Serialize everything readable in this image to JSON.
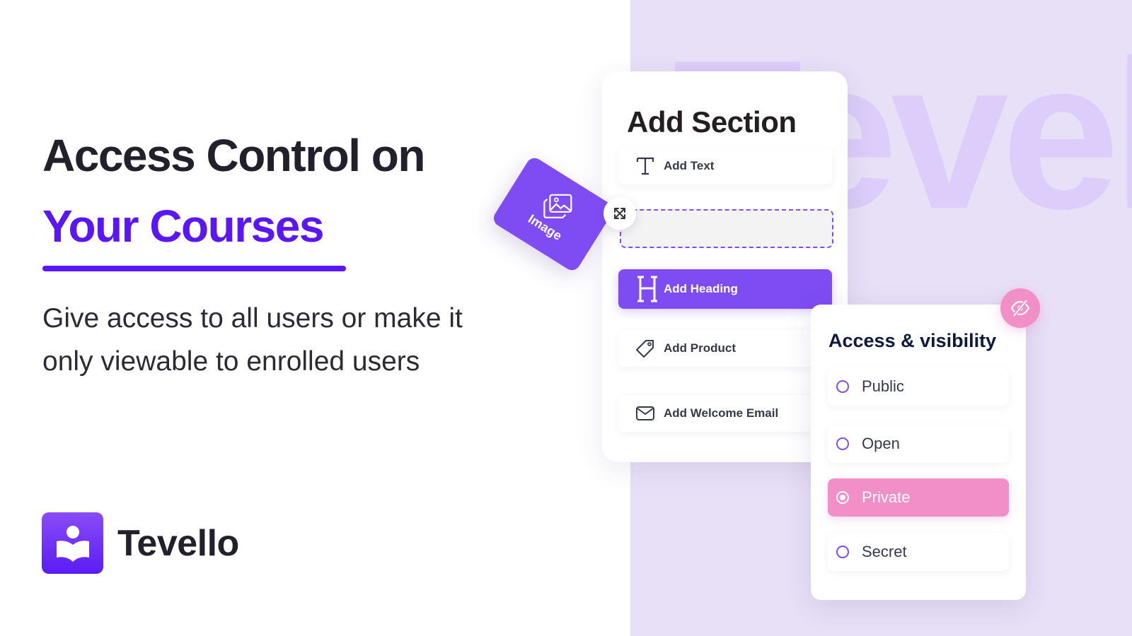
{
  "hero": {
    "headline": "Access Control on",
    "headline_accent": "Your Courses",
    "subtitle_line1": "Give access to all users or make it",
    "subtitle_line2": "only viewable to enrolled users"
  },
  "brand": {
    "name": "Tevello",
    "logo_icon": "book-reader-icon",
    "watermark": "Tevel"
  },
  "add_section": {
    "title": "Add Section",
    "items": [
      {
        "label": "Add Text",
        "icon": "text-icon"
      },
      {
        "label": "Add Heading",
        "icon": "heading-icon",
        "active": true
      },
      {
        "label": "Add Product",
        "icon": "tag-icon"
      },
      {
        "label": "Add Welcome Email",
        "icon": "mail-icon"
      }
    ],
    "dragging_tile": {
      "label": "Image",
      "icon": "image-icon"
    },
    "move_handle_icon": "move-arrows-icon"
  },
  "visibility": {
    "title": "Access & visibility",
    "badge_icon": "eye-off-icon",
    "options": [
      {
        "label": "Public",
        "selected": false
      },
      {
        "label": "Open",
        "selected": false
      },
      {
        "label": "Private",
        "selected": true
      },
      {
        "label": "Secret",
        "selected": false
      }
    ],
    "selected": "Private"
  },
  "colors": {
    "accent_purple": "#5b16f5",
    "button_purple": "#7f4cf4",
    "pink": "#f28fc8",
    "panel_lavender": "#e8e0f7",
    "text_dark": "#22212b"
  }
}
